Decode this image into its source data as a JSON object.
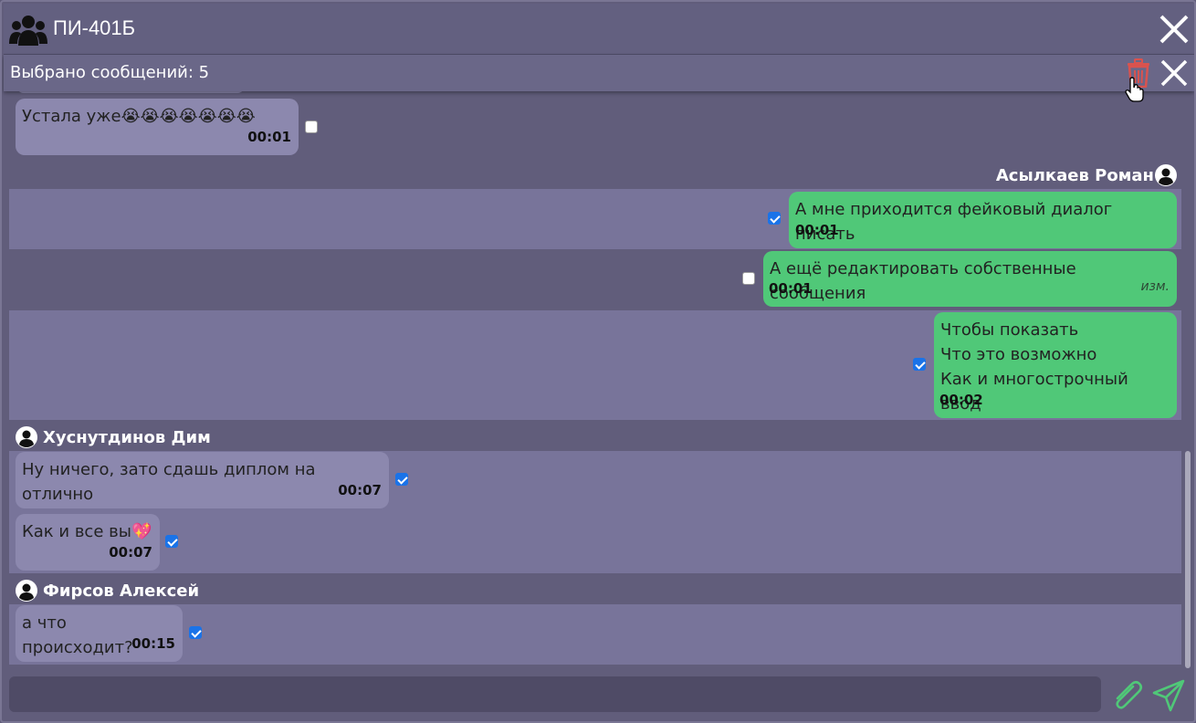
{
  "header": {
    "title": "ПИ-401Б"
  },
  "selection": {
    "count_label": "Выбрано сообщений: 5"
  },
  "messages": [
    {
      "text": "Устала уже😭😭😭😭😭😭😭",
      "time": "00:01",
      "checked": false
    },
    {
      "sender": "Асылкаев Роман"
    },
    {
      "text": "А мне приходится фейковый диалог писать",
      "time": "00:01",
      "checked": true
    },
    {
      "text": "А ещё редактировать собственные сообщения",
      "time": "00:01",
      "edited": "изм.",
      "checked": false
    },
    {
      "lines": [
        "Чтобы показать",
        "Что это возможно",
        "Как и многострочный ввод"
      ],
      "time": "00:02",
      "checked": true
    },
    {
      "sender": "Хуснутдинов Дим"
    },
    {
      "text": "Ну ничего, зато сдашь диплом на отлично",
      "time": "00:07",
      "checked": true
    },
    {
      "text": "Как и все вы💖",
      "time": "00:07",
      "checked": true
    },
    {
      "sender": "Фирсов Алексей"
    },
    {
      "text": "а что происходит?",
      "time": "00:15",
      "checked": true
    }
  ],
  "composer": {
    "value": ""
  },
  "colors": {
    "outgoing": "#50c878",
    "incoming": "#8c88ae",
    "selected_row": "#78749a",
    "trash": "#d9534f",
    "checkbox": "#1a73e8"
  },
  "icons": [
    "group-icon",
    "close-icon",
    "trash-icon",
    "user-icon",
    "paperclip-icon",
    "send-icon"
  ]
}
